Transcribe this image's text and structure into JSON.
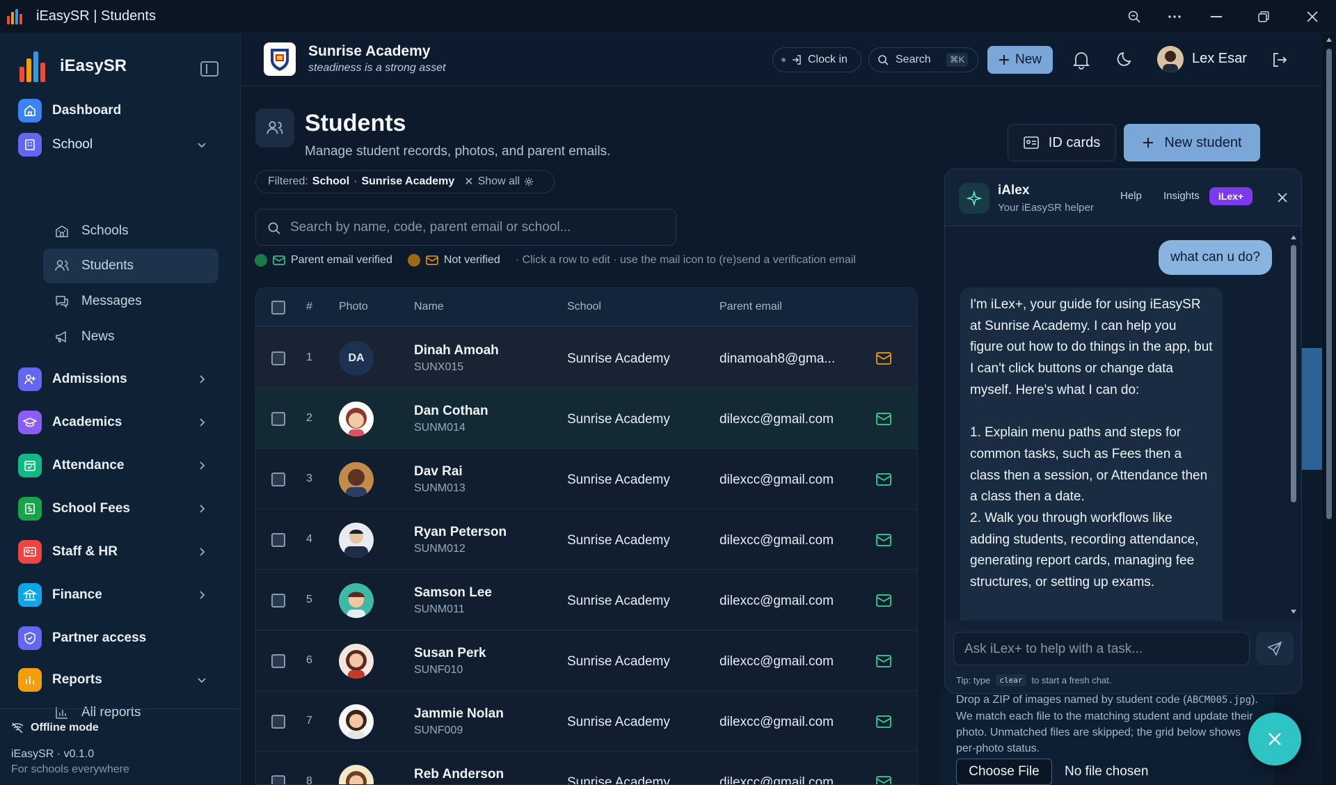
{
  "window": {
    "title": "iEasySR | Students"
  },
  "sidebar": {
    "brand": "iEasySR",
    "items": [
      {
        "label": "Dashboard",
        "icon": "home-icon",
        "color": "#3b82f6"
      },
      {
        "label": "School",
        "icon": "building-icon",
        "color": "#6366f1"
      },
      {
        "label": "Admissions",
        "icon": "user-plus-icon",
        "color": "#6366f1"
      },
      {
        "label": "Academics",
        "icon": "graduation-cap-icon",
        "color": "#8b5cf6"
      },
      {
        "label": "Attendance",
        "icon": "calendar-check-icon",
        "color": "#10b981"
      },
      {
        "label": "School Fees",
        "icon": "receipt-icon",
        "color": "#16a34a"
      },
      {
        "label": "Staff & HR",
        "icon": "id-badge-icon",
        "color": "#ef4444"
      },
      {
        "label": "Finance",
        "icon": "bank-icon",
        "color": "#0ea5e9"
      },
      {
        "label": "Partner access",
        "icon": "shield-icon",
        "color": "#6366f1"
      },
      {
        "label": "Reports",
        "icon": "bar-chart-icon",
        "color": "#f59e0b"
      }
    ],
    "school_sub": [
      {
        "label": "Schools",
        "icon": "school-icon"
      },
      {
        "label": "Students",
        "icon": "users-icon"
      },
      {
        "label": "Messages",
        "icon": "message-icon"
      },
      {
        "label": "News",
        "icon": "megaphone-icon"
      }
    ],
    "reports_sub": [
      {
        "label": "All reports",
        "icon": "chart-icon"
      }
    ],
    "offline": "Offline mode",
    "version": "iEasySR · v0.1.0",
    "tagline": "For schools everywhere"
  },
  "topbar": {
    "school_name": "Sunrise Academy",
    "motto": "steadiness is a strong asset",
    "clock_in": "Clock in",
    "search_label": "Search",
    "search_kbd": "⌘K",
    "new_label": "New",
    "user_name": "Lex Esar"
  },
  "page": {
    "title": "Students",
    "subtitle": "Manage student records, photos, and parent emails.",
    "id_cards": "ID cards",
    "new_student": "New student",
    "filter": {
      "prefix": "Filtered:",
      "school_key": "School",
      "sep": "·",
      "school_value": "Sunrise Academy",
      "show_all": "Show all"
    },
    "search_placeholder": "Search by name, code, parent email or school...",
    "legend": {
      "verified": "Parent email verified",
      "not_verified": "Not verified",
      "hint": "· Click a row to edit · use the mail icon to (re)send a verification email"
    }
  },
  "table": {
    "headers": [
      "#",
      "Photo",
      "Name",
      "School",
      "Parent email"
    ],
    "rows": [
      {
        "n": "1",
        "initials": "DA",
        "name": "Dinah Amoah",
        "code": "SUNX015",
        "school": "Sunrise Academy",
        "email": "dinamoah8@gma...",
        "verified": false
      },
      {
        "n": "2",
        "initials": "",
        "name": "Dan Cothan",
        "code": "SUNM014",
        "school": "Sunrise Academy",
        "email": "dilexcc@gmail.com",
        "verified": true
      },
      {
        "n": "3",
        "initials": "",
        "name": "Dav Rai",
        "code": "SUNM013",
        "school": "Sunrise Academy",
        "email": "dilexcc@gmail.com",
        "verified": true
      },
      {
        "n": "4",
        "initials": "",
        "name": "Ryan Peterson",
        "code": "SUNM012",
        "school": "Sunrise Academy",
        "email": "dilexcc@gmail.com",
        "verified": true
      },
      {
        "n": "5",
        "initials": "",
        "name": "Samson Lee",
        "code": "SUNM011",
        "school": "Sunrise Academy",
        "email": "dilexcc@gmail.com",
        "verified": true
      },
      {
        "n": "6",
        "initials": "",
        "name": "Susan Perk",
        "code": "SUNF010",
        "school": "Sunrise Academy",
        "email": "dilexcc@gmail.com",
        "verified": true
      },
      {
        "n": "7",
        "initials": "",
        "name": "Jammie Nolan",
        "code": "SUNF009",
        "school": "Sunrise Academy",
        "email": "dilexcc@gmail.com",
        "verified": true
      },
      {
        "n": "8",
        "initials": "",
        "name": "Reb Anderson",
        "code": "",
        "school": "Sunrise Academy",
        "email": "dilexcc@gmail.com",
        "verified": true
      }
    ]
  },
  "chat": {
    "name": "iAlex",
    "subtitle": "Your iEasySR helper",
    "tabs": [
      "Help",
      "Insights",
      "iLex+"
    ],
    "user_msg": "what can u do?",
    "bot_msg": "I'm iLex+, your guide for using iEasySR at Sunrise Academy. I can help you figure out how to do things in the app, but I can't click buttons or change data myself. Here's what I can do:\n\n1. Explain menu paths and steps for common tasks, such as Fees then a class then a session, or Attendance then a class then a date.\n2. Walk you through workflows like adding students, recording attendance, generating report cards, managing fee structures, or setting up exams.",
    "input_placeholder": "Ask iLex+ to help with a task...",
    "tip_prefix": "Tip: type",
    "tip_code": "clear",
    "tip_suffix": "to start a fresh chat."
  },
  "upload": {
    "line1": "Drop a ZIP of images named by student code",
    "code_example": "ABCM005.jpg",
    "line2": "). We match each file to the matching student and update their photo. Unmatched files are skipped; the grid below shows per-photo status.",
    "choose": "Choose File",
    "no_file": "No file chosen"
  }
}
